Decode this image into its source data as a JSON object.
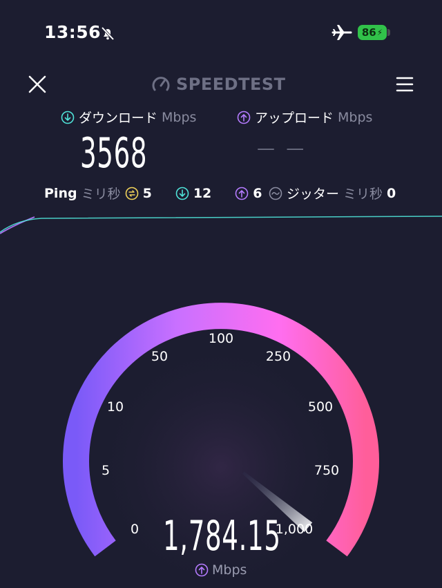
{
  "status_bar": {
    "time": "13:56",
    "battery": "86"
  },
  "header": {
    "brand": "SPEEDTEST"
  },
  "download": {
    "label": "ダウンロード",
    "unit": "Mbps",
    "value": "3568"
  },
  "upload": {
    "label": "アップロード",
    "unit": "Mbps",
    "value": "— —"
  },
  "ping": {
    "label": "Ping",
    "unit": "ミリ秒",
    "idle": "5",
    "download": "12",
    "upload": "6"
  },
  "jitter": {
    "label": "ジッター",
    "unit": "ミリ秒",
    "value": "0"
  },
  "gauge": {
    "ticks": [
      "0",
      "5",
      "10",
      "50",
      "100",
      "250",
      "500",
      "750",
      "1,000"
    ],
    "speed": "1,784.15",
    "unit": "Mbps",
    "needle_level": 1.0
  },
  "colors": {
    "background": "#1c1d30",
    "download_accent": "#4fe3d8",
    "upload_accent": "#b57bff",
    "idle_accent": "#f0d25a",
    "arc_start": "#7a5af8",
    "arc_end": "#ff5e9a"
  },
  "icons": [
    "bell-slash-icon",
    "airplane-icon",
    "close-icon",
    "speedometer-icon",
    "menu-icon",
    "download-arrow-icon",
    "upload-arrow-icon",
    "idle-icon",
    "jitter-icon"
  ]
}
